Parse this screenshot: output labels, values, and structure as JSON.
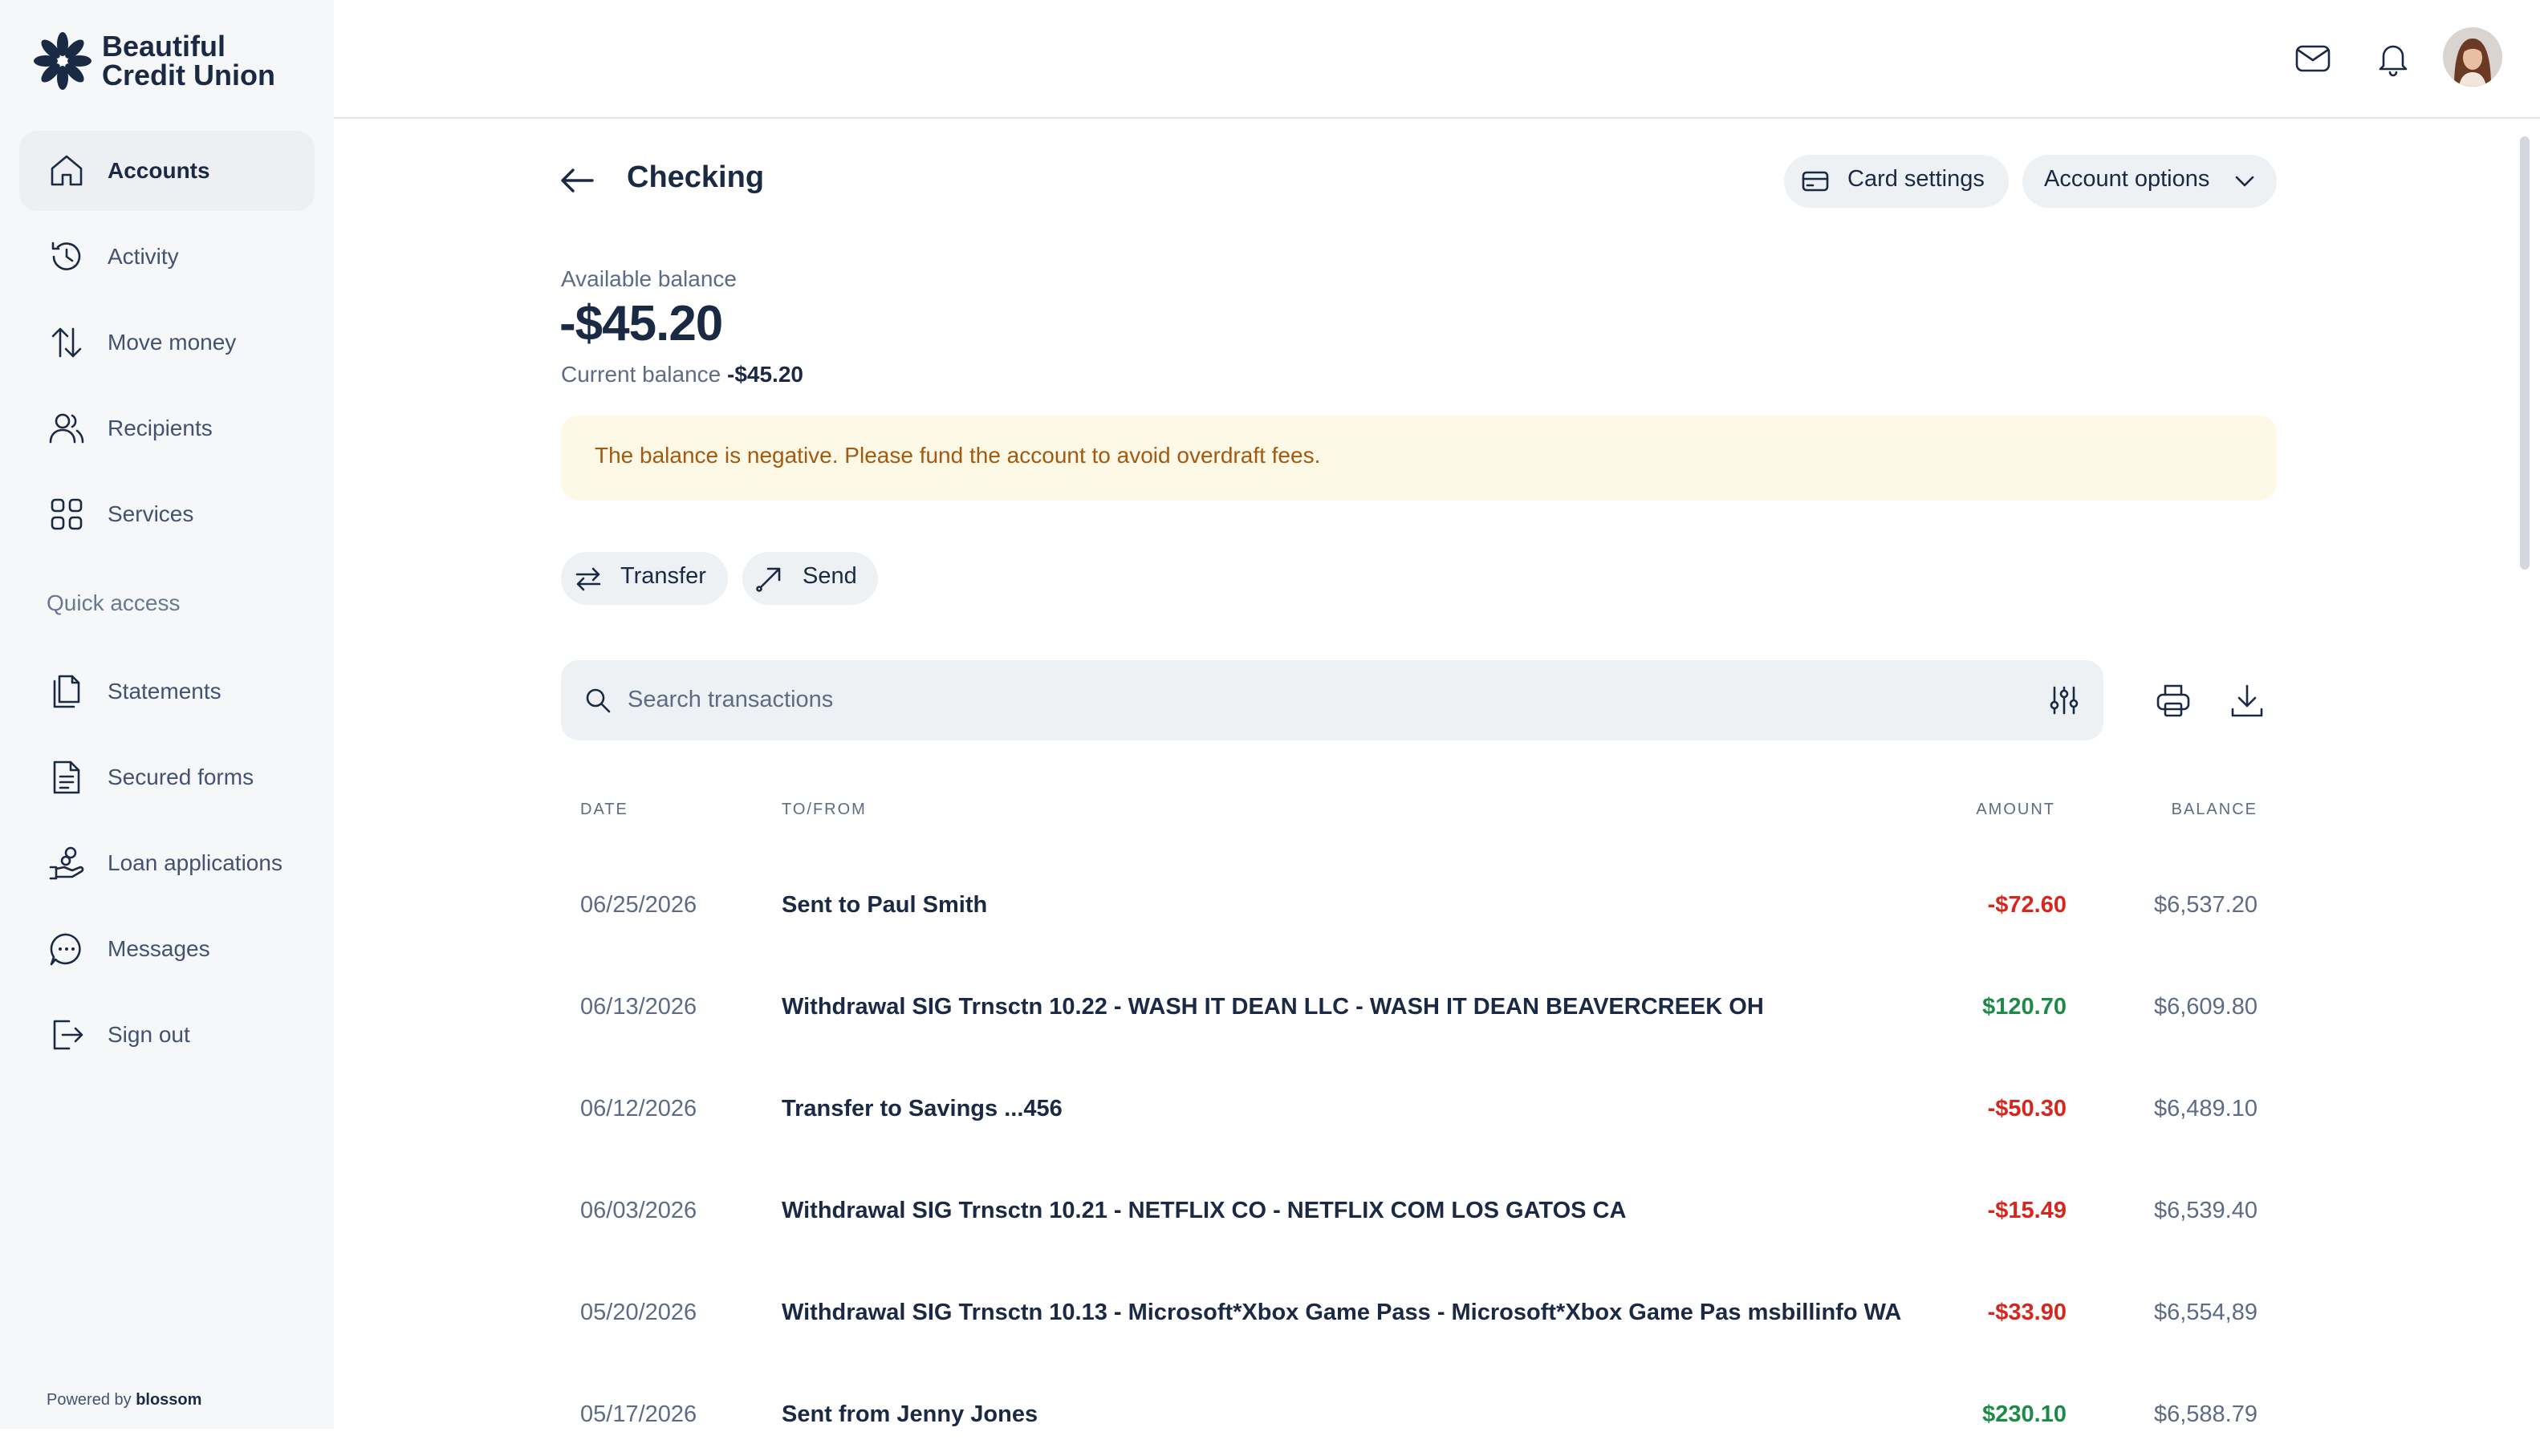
{
  "brand": {
    "line1": "Beautiful",
    "line2": "Credit Union"
  },
  "sidebar": {
    "items": [
      {
        "label": "Accounts",
        "icon": "home-icon",
        "active": true
      },
      {
        "label": "Activity",
        "icon": "history-icon"
      },
      {
        "label": "Move money",
        "icon": "arrows-updown-icon"
      },
      {
        "label": "Recipients",
        "icon": "users-icon"
      },
      {
        "label": "Services",
        "icon": "grid-icon"
      }
    ],
    "section_label": "Quick access",
    "quick_items": [
      {
        "label": "Statements",
        "icon": "documents-icon"
      },
      {
        "label": "Secured forms",
        "icon": "form-icon"
      },
      {
        "label": "Loan applications",
        "icon": "hand-coins-icon"
      },
      {
        "label": "Messages",
        "icon": "chat-icon"
      },
      {
        "label": "Sign out",
        "icon": "sign-out-icon"
      }
    ],
    "powered_prefix": "Powered by",
    "powered_brand": "blossom"
  },
  "header": {
    "icons": [
      "mail-icon",
      "bell-icon"
    ],
    "avatar": "user-avatar"
  },
  "account": {
    "title": "Checking",
    "card_settings": "Card settings",
    "account_options": "Account options",
    "available_label": "Available balance",
    "available_amount": "-$45.20",
    "current_label": "Current balance",
    "current_amount": "-$45.20",
    "alert": "The balance is negative. Please fund the account to avoid overdraft fees.",
    "transfer": "Transfer",
    "send": "Send"
  },
  "search": {
    "placeholder": "Search transactions"
  },
  "table": {
    "headers": {
      "date": "DATE",
      "to_from": "TO/FROM",
      "amount": "AMOUNT",
      "balance": "BALANCE"
    },
    "rows": [
      {
        "date": "06/25/2026",
        "desc": "Sent to Paul Smith",
        "amount": "-$72.60",
        "balance": "$6,537.20",
        "type": "debit"
      },
      {
        "date": "06/13/2026",
        "desc": "Withdrawal SIG Trnsctn 10.22 - WASH IT DEAN LLC - WASH IT DEAN BEAVERCREEK OH",
        "amount": "$120.70",
        "balance": "$6,609.80",
        "type": "credit"
      },
      {
        "date": "06/12/2026",
        "desc": "Transfer to Savings ...456",
        "amount": "-$50.30",
        "balance": "$6,489.10",
        "type": "debit"
      },
      {
        "date": "06/03/2026",
        "desc": "Withdrawal SIG Trnsctn 10.21 - NETFLIX CO - NETFLIX COM LOS GATOS CA",
        "amount": "-$15.49",
        "balance": "$6,539.40",
        "type": "debit"
      },
      {
        "date": "05/20/2026",
        "desc": "Withdrawal SIG Trnsctn 10.13 - Microsoft*Xbox Game Pass - Microsoft*Xbox Game Pas msbillinfo WA",
        "amount": "-$33.90",
        "balance": "$6,554,89",
        "type": "debit"
      },
      {
        "date": "05/17/2026",
        "desc": "Sent from Jenny Jones",
        "amount": "$230.10",
        "balance": "$6,588.79",
        "type": "credit"
      }
    ]
  },
  "colors": {
    "debit": "#d6261e",
    "credit": "#1e8a48",
    "alert_bg": "#fef8e6",
    "alert_text": "#a25a10",
    "brand": "#1b2a44"
  }
}
